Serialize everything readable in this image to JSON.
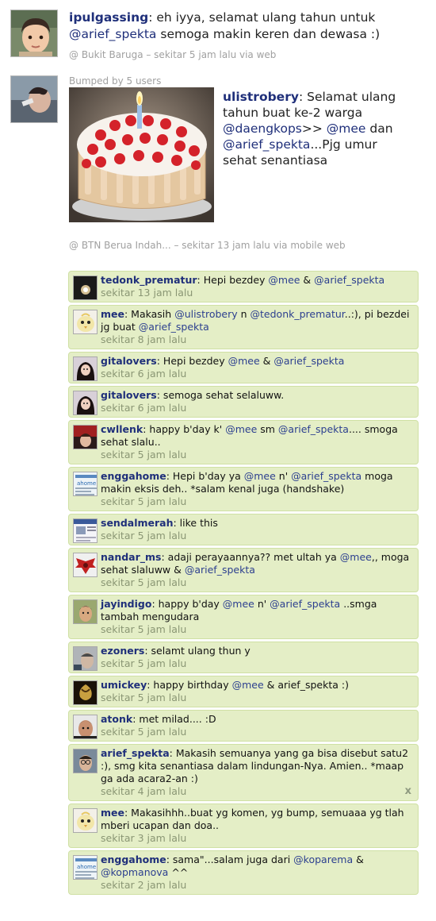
{
  "post1": {
    "user": "ipulgassing",
    "text_before": ": eh iyya, selamat ulang tahun untuk ",
    "mention": "@arief_spekta",
    "text_after": " semoga makin keren dan dewasa :)",
    "meta": "@ Bukit Baruga – sekitar 5 jam lalu via web"
  },
  "post2": {
    "bumped": "Bumped by 5 users",
    "user": "ulistrobery",
    "t1": ": Selamat ulang tahun buat ke-2 warga ",
    "m1": "@daengkops",
    "t2": ">> ",
    "m2": "@mee",
    "t3": " dan ",
    "m3": "@arief_spekta",
    "t4": "...Pjg umur sehat senantiasa",
    "meta": "@ BTN Berua Indah... – sekitar 13 jam lalu via mobile web"
  },
  "comments": [
    {
      "user": "tedonk_prematur",
      "parts": [
        ": Hepi bezdey ",
        {
          "m": "@mee"
        },
        " & ",
        {
          "m": "@arief_spekta"
        }
      ],
      "time": "sekitar 13 jam lalu",
      "avatar": "dark-avatar"
    },
    {
      "user": "mee",
      "parts": [
        ": Makasih ",
        {
          "m": "@ulistrobery"
        },
        " n ",
        {
          "m": "@tedonk_prematur"
        },
        "..:), pi bezdei jg buat ",
        {
          "m": "@arief_spekta"
        }
      ],
      "time": "sekitar 8 jam lalu",
      "avatar": "chick-avatar"
    },
    {
      "user": "gitalovers",
      "parts": [
        ": Hepi bezdey ",
        {
          "m": "@mee"
        },
        " & ",
        {
          "m": "@arief_spekta"
        }
      ],
      "time": "sekitar 6 jam lalu",
      "avatar": "girl-avatar"
    },
    {
      "user": "gitalovers",
      "parts": [
        ": semoga sehat selaluww."
      ],
      "time": "sekitar 6 jam lalu",
      "avatar": "girl-avatar"
    },
    {
      "user": "cwllenk",
      "parts": [
        ": happy b'day k' ",
        {
          "m": "@mee"
        },
        " sm ",
        {
          "m": "@arief_spekta"
        },
        ".... smoga sehat slalu.."
      ],
      "time": "sekitar 5 jam lalu",
      "avatar": "red-avatar"
    },
    {
      "user": "enggahome",
      "parts": [
        ": Hepi b'day ya ",
        {
          "m": "@mee"
        },
        " n' ",
        {
          "m": "@arief_spekta"
        },
        " moga makin eksis deh.. *salam kenal juga (handshake)"
      ],
      "time": "sekitar 5 jam lalu",
      "avatar": "text-avatar"
    },
    {
      "user": "sendalmerah",
      "parts": [
        ": like this"
      ],
      "time": "sekitar 5 jam lalu",
      "avatar": "screen-avatar"
    },
    {
      "user": "nandar_ms",
      "parts": [
        ": adaji perayaannya?? met ultah ya ",
        {
          "m": "@mee"
        },
        ",, moga sehat slaluww & ",
        {
          "m": "@arief_spekta"
        }
      ],
      "time": "sekitar 5 jam lalu",
      "avatar": "wings-avatar"
    },
    {
      "user": "jayindigo",
      "parts": [
        ": happy b'day ",
        {
          "m": "@mee"
        },
        " n' ",
        {
          "m": "@arief_spekta"
        },
        " ..smga tambah mengudara"
      ],
      "time": "sekitar 5 jam lalu",
      "avatar": "man-avatar"
    },
    {
      "user": "ezoners",
      "parts": [
        ": selamt ulang thun y"
      ],
      "time": "sekitar 5 jam lalu",
      "avatar": "grey-avatar"
    },
    {
      "user": "umickey",
      "parts": [
        ": happy birthday ",
        {
          "m": "@mee"
        },
        " & arief_spekta :)"
      ],
      "time": "sekitar 5 jam lalu",
      "avatar": "gold-avatar"
    },
    {
      "user": "atonk",
      "parts": [
        ": met milad.... :D"
      ],
      "time": "sekitar 5 jam lalu",
      "avatar": "face-avatar"
    },
    {
      "user": "arief_spekta",
      "parts": [
        ": Makasih semuanya yang ga bisa disebut satu2 :), smg kita senantiasa dalam lindungan-Nya. Amien.. *maap ga ada acara2-an :)"
      ],
      "time": "sekitar 4 jam lalu",
      "avatar": "glasses-avatar",
      "close": "x"
    },
    {
      "user": "mee",
      "parts": [
        ": Makasihhh..buat yg komen, yg bump, semuaaa yg tlah mberi ucapan dan doa.."
      ],
      "time": "sekitar 3 jam lalu",
      "avatar": "chick-avatar"
    },
    {
      "user": "enggahome",
      "parts": [
        ": sama\"...salam juga dari ",
        {
          "m": "@koparema"
        },
        " & ",
        {
          "m": "@kopmanova"
        },
        " ^^"
      ],
      "time": "sekitar 2 jam lalu",
      "avatar": "text-avatar"
    }
  ]
}
